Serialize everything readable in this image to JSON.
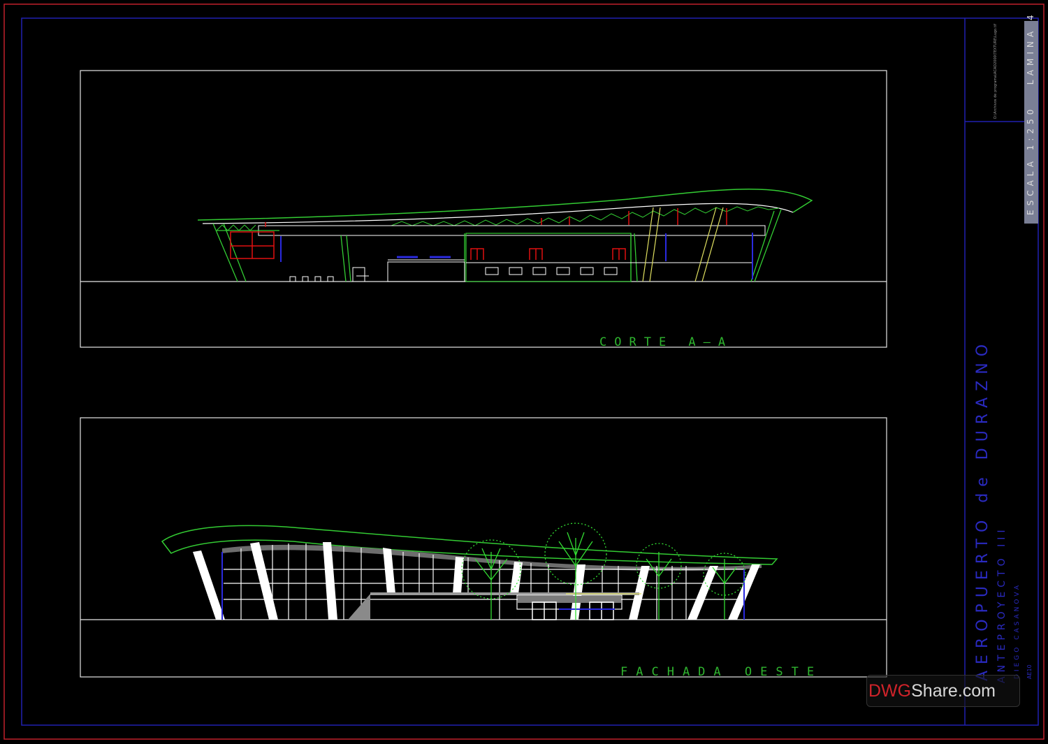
{
  "colors": {
    "outer_border": "#c0202a",
    "inner_border": "#2020b0",
    "frame": "#e6e6e6",
    "roof": "#33cc33",
    "structure": "#ffffff",
    "accent_red": "#e01010",
    "accent_blue": "#2a2ae0",
    "accent_yellow": "#e0e060",
    "tree": "#33dd33",
    "label": "#2fb52f"
  },
  "drawing": {
    "section_label": "CORTE A—A",
    "elevation_label": "FACHADA OESTE"
  },
  "title_block": {
    "project": "AEROPUERTO de DURAZNO",
    "subtitle": "ANTEPROYECTO III",
    "author": "DIEGO CASANOVA",
    "code": "AE10",
    "file_path": "D:\\Archivos de programa\\ACAD2000\\TEXTURE\\Lugo.tif",
    "scale_label": "ESCALA 1:250",
    "sheet_label": "LAMINA 4"
  },
  "watermark": {
    "brand_a": "DWG",
    "brand_b": "Share.com"
  }
}
